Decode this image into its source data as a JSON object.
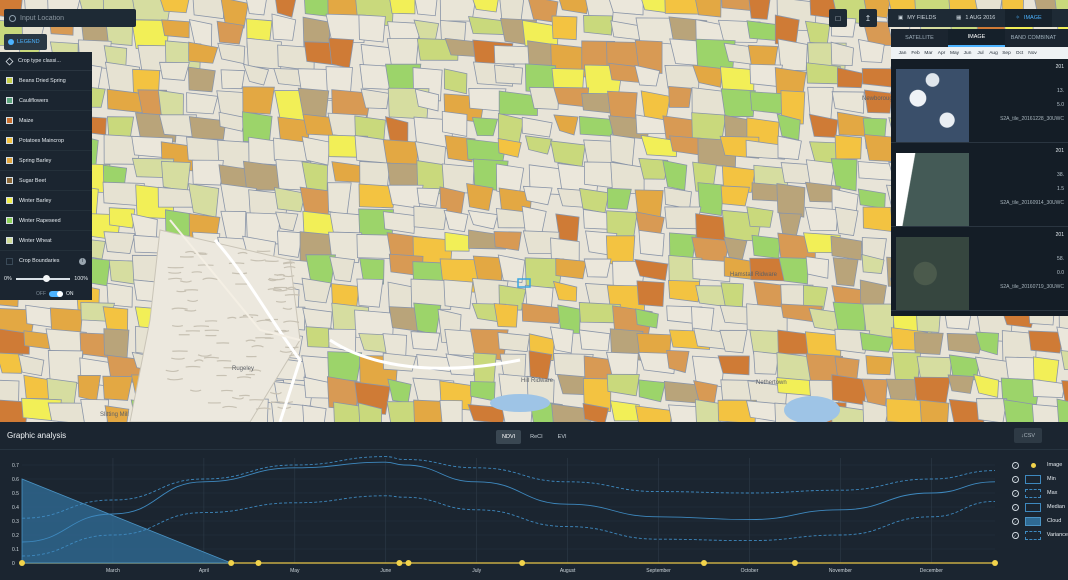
{
  "search": {
    "placeholder": "Input Location"
  },
  "legend_button": {
    "label": "LEGEND"
  },
  "legend": {
    "title": "Crop type classi...",
    "items": [
      {
        "label": "Beans Dried Spring",
        "color": "#c6cf4a"
      },
      {
        "label": "Cauliflowers",
        "color": "#5ea57d"
      },
      {
        "label": "Maize",
        "color": "#c86f2f"
      },
      {
        "label": "Potatoes Maincrop",
        "color": "#f3c341"
      },
      {
        "label": "Spring Barley",
        "color": "#e0a63f"
      },
      {
        "label": "Sugar Beet",
        "color": "#8c6a3a"
      },
      {
        "label": "Winter Barley",
        "color": "#f0ee4a"
      },
      {
        "label": "Winter Rapeseed",
        "color": "#8fd35a"
      },
      {
        "label": "Winter Wheat",
        "color": "#cfdc97"
      }
    ],
    "boundaries_label": "Crop Boundaries",
    "info": "i",
    "slider": {
      "min_label": "0%",
      "max_label": "100%",
      "value": 0.55
    },
    "toggle": {
      "off": "OFF",
      "on": "ON"
    }
  },
  "top_bar": {
    "my_fields": "MY FIELDS",
    "date": "1 AUG 2016",
    "image": "IMAGE"
  },
  "image_panel": {
    "tabs": [
      "SATELLITE",
      "IMAGE",
      "BAND COMBINAT"
    ],
    "months": [
      "Jan",
      "Feb",
      "Mar",
      "Apr",
      "May",
      "Jun",
      "Jul",
      "Aug",
      "Sep",
      "Oct",
      "Nov"
    ],
    "shots": [
      {
        "year": "201",
        "v1": "13.",
        "v2": "5.0",
        "name": "S2A_tile_20161228_30UWC"
      },
      {
        "year": "201",
        "v1": "38.",
        "v2": "1.5",
        "name": "S2A_tile_20160914_30UWC"
      },
      {
        "year": "201",
        "v1": "58.",
        "v2": "0.0",
        "name": "S2A_tile_20160719_30UWC"
      }
    ]
  },
  "map_labels": [
    "Rugeley",
    "Slitting Mill",
    "Hill Ridware",
    "Hamstall Ridware",
    "Newborough",
    "Nethertown"
  ],
  "analysis": {
    "title": "Graphic analysis",
    "tabs": [
      "NDVI",
      "ReCI",
      "EVI"
    ],
    "csv": "↓CSV",
    "legend": [
      "Image",
      "Min",
      "Max",
      "Median",
      "Cloud",
      "Variance"
    ]
  },
  "chart_data": {
    "type": "line",
    "x_ticks": [
      "March",
      "April",
      "May",
      "June",
      "July",
      "August",
      "September",
      "October",
      "November",
      "December"
    ],
    "y_ticks": [
      0,
      0.1,
      0.2,
      0.3,
      0.4,
      0.5,
      0.6,
      0.7
    ],
    "ylim": [
      0,
      0.75
    ],
    "xlim": [
      2,
      12.7
    ],
    "series": [
      {
        "name": "Max",
        "style": "dashed",
        "x": [
          2,
          3,
          4,
          5,
          6,
          6.2,
          7,
          8,
          9,
          10,
          11,
          12,
          12.7
        ],
        "y": [
          0.32,
          0.45,
          0.6,
          0.7,
          0.76,
          0.74,
          0.68,
          0.58,
          0.51,
          0.5,
          0.52,
          0.6,
          0.66
        ]
      },
      {
        "name": "Median",
        "style": "solid",
        "x": [
          2,
          3,
          4,
          5,
          6,
          6.2,
          7,
          8,
          9,
          10,
          11,
          12,
          12.7
        ],
        "y": [
          0.15,
          0.35,
          0.58,
          0.68,
          0.72,
          0.7,
          0.58,
          0.42,
          0.33,
          0.31,
          0.38,
          0.5,
          0.58
        ]
      },
      {
        "name": "Min",
        "style": "dashed",
        "x": [
          2,
          3,
          4,
          5,
          6,
          6.2,
          7,
          8,
          9,
          10,
          11,
          12,
          12.7
        ],
        "y": [
          0.05,
          0.2,
          0.36,
          0.43,
          0.48,
          0.47,
          0.38,
          0.26,
          0.17,
          0.16,
          0.2,
          0.33,
          0.44
        ]
      },
      {
        "name": "Cloud",
        "style": "area",
        "x": [
          2,
          4.3
        ],
        "y": [
          0.6,
          0
        ]
      }
    ],
    "image_points": {
      "x": [
        2,
        4.3,
        4.6,
        6.15,
        6.25,
        7.5,
        9.5,
        10.5,
        12.7
      ],
      "y": [
        0,
        0,
        0,
        0,
        0,
        0,
        0,
        0,
        0
      ]
    }
  }
}
